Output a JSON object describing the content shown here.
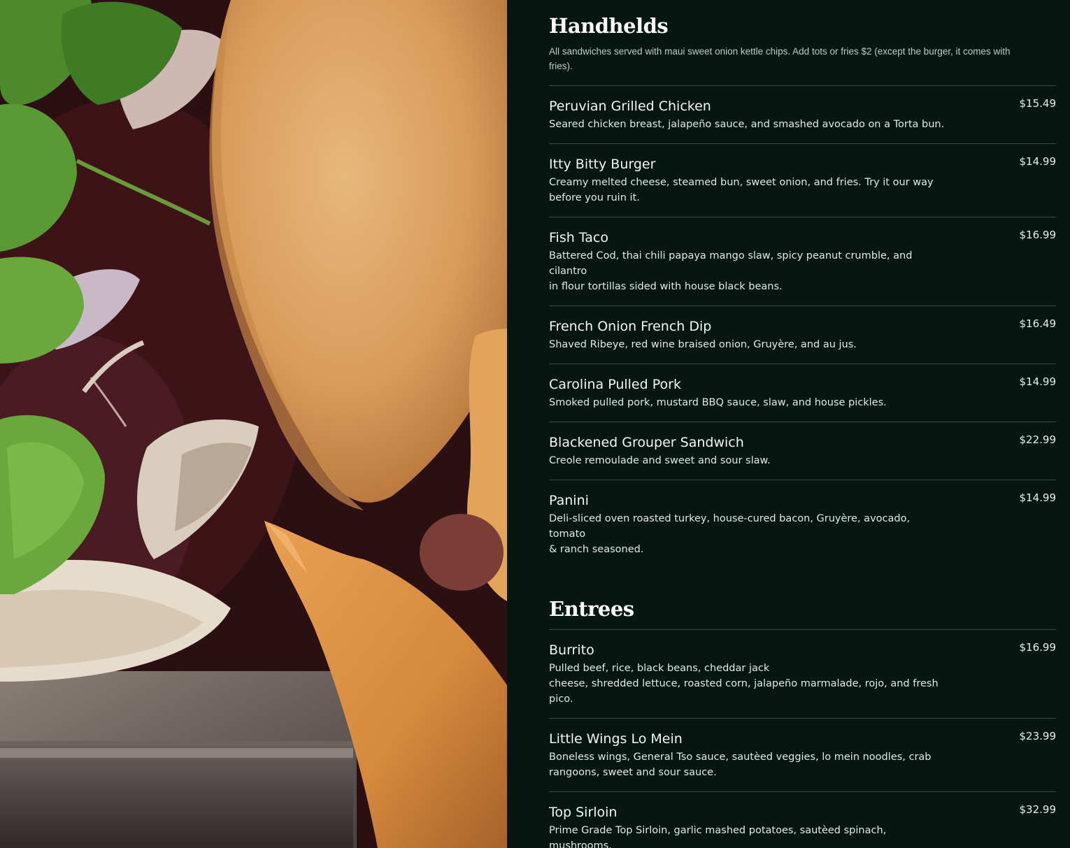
{
  "handhelds": {
    "title": "Handhelds",
    "note_lines": [
      "All sandwiches served with maui sweet onion kettle chips. Add tots or fries $2 (except the burger, it comes with",
      "fries)."
    ],
    "items": [
      {
        "name": "Peruvian Grilled Chicken",
        "price": "$15.49",
        "desc_lines": [
          "Seared chicken breast, jalapeño sauce, and smashed avocado on a Torta bun."
        ]
      },
      {
        "name": "Itty Bitty Burger",
        "price": "$14.99",
        "desc_lines": [
          "Creamy melted cheese, steamed bun, sweet onion, and fries. Try it our way",
          "before you ruin it."
        ]
      },
      {
        "name": "Fish Taco",
        "price": "$16.99",
        "desc_lines": [
          "Battered Cod, thai chili papaya mango slaw, spicy peanut crumble, and cilantro",
          "in flour tortillas sided with house black beans."
        ]
      },
      {
        "name": "French Onion French Dip",
        "price": "$16.49",
        "desc_lines": [
          "Shaved Ribeye, red wine braised onion, Gruyère, and au jus."
        ]
      },
      {
        "name": "Carolina Pulled Pork",
        "price": "$14.99",
        "desc_lines": [
          "Smoked pulled pork, mustard BBQ sauce, slaw, and house pickles."
        ]
      },
      {
        "name": "Blackened Grouper Sandwich",
        "price": "$22.99",
        "desc_lines": [
          "Creole remoulade and sweet and sour slaw."
        ]
      },
      {
        "name": "Panini",
        "price": "$14.99",
        "desc_lines": [
          "Deli-sliced oven roasted turkey, house-cured bacon, Gruyère, avocado, tomato",
          "& ranch seasoned."
        ]
      }
    ]
  },
  "entrees": {
    "title": "Entrees",
    "items": [
      {
        "name": "Burrito",
        "price": "$16.99",
        "desc_lines": [
          "Pulled beef, rice, black beans, cheddar jack",
          "cheese, shredded lettuce, roasted corn, jalapeño marmalade, rojo, and fresh",
          "pico."
        ]
      },
      {
        "name": "Little Wings Lo Mein",
        "price": "$23.99",
        "desc_lines": [
          "Boneless wings, General Tso sauce, sautèed veggies, lo mein noodles, crab",
          "rangoons, sweet and sour sauce."
        ]
      },
      {
        "name": "Top Sirloin",
        "price": "$32.99",
        "desc_lines": [
          "Prime Grade Top Sirloin, garlic mashed potatoes, sautèed spinach, mushrooms,"
        ]
      }
    ]
  },
  "colors": {
    "panel_bg": "#061712",
    "divider": "#3b4a44",
    "text": "#f4f6f5"
  }
}
